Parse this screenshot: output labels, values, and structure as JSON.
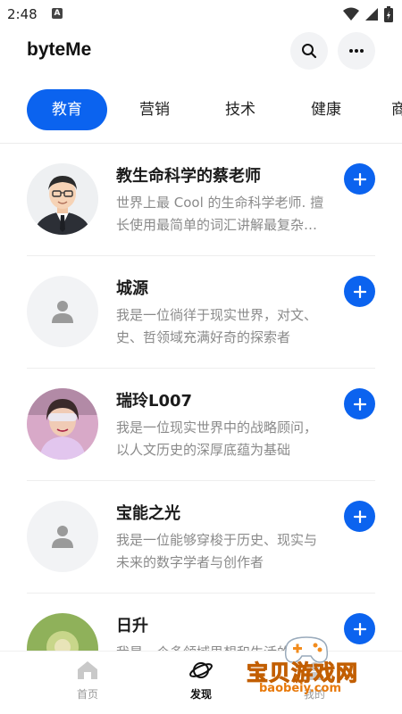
{
  "status_bar": {
    "time": "2:48",
    "notification_letter": "A"
  },
  "app": {
    "title": "byteMe"
  },
  "tabs": [
    {
      "label": "教育",
      "active": true
    },
    {
      "label": "营销",
      "active": false
    },
    {
      "label": "技术",
      "active": false
    },
    {
      "label": "健康",
      "active": false
    },
    {
      "label": "商",
      "active": false
    }
  ],
  "feed": [
    {
      "name": "教生命科学的蔡老师",
      "desc": "世界上最 Cool 的生命科学老师. 擅长使用最简单的词汇讲解最复杂的知识",
      "avatar": "cartoon-teacher"
    },
    {
      "name": "城源",
      "desc": "我是一位徜徉于现实世界，对文、史、哲领域充满好奇的探索者",
      "avatar": "default-person"
    },
    {
      "name": "瑞玲L007",
      "desc": "我是一位现实世界中的战略顾问，以人文历史的深厚底蕴为基础",
      "avatar": "photo-woman"
    },
    {
      "name": "宝能之光",
      "desc": "我是一位能够穿梭于历史、现实与未来的数字学者与创作者",
      "avatar": "default-person"
    },
    {
      "name": "日升",
      "desc": "我是一个多领域思想和生活的记录者",
      "avatar": "photo-flower"
    }
  ],
  "bottom_nav": [
    {
      "label": "首页",
      "icon": "home-icon",
      "active": false
    },
    {
      "label": "发现",
      "icon": "planet-icon",
      "active": true
    },
    {
      "label": "我的",
      "icon": "profile-icon",
      "active": false
    }
  ],
  "watermark": {
    "title": "宝贝游戏网",
    "url": "baobeiy.com"
  },
  "colors": {
    "accent": "#0b63ef",
    "text_secondary": "#8a8a8a",
    "watermark": "#f28c1d"
  }
}
